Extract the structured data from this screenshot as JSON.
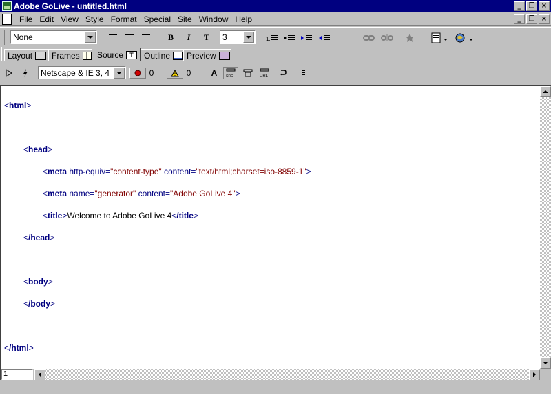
{
  "window": {
    "title": "Adobe GoLive - untitled.html"
  },
  "menu": [
    {
      "underline": "F",
      "rest": "ile"
    },
    {
      "underline": "E",
      "rest": "dit"
    },
    {
      "underline": "V",
      "rest": "iew"
    },
    {
      "underline": "S",
      "rest": "tyle"
    },
    {
      "underline": "F",
      "rest": "ormat"
    },
    {
      "underline": "S",
      "rest": "pecial"
    },
    {
      "underline": "S",
      "rest": "ite"
    },
    {
      "underline": "W",
      "rest": "indow"
    },
    {
      "underline": "H",
      "rest": "elp"
    }
  ],
  "toolbar": {
    "paragraph_format": "None",
    "bold": "B",
    "italic": "I",
    "teletype": "T",
    "font_size": "3"
  },
  "tabs": [
    "Layout",
    "Frames",
    "Source",
    "Outline",
    "Preview"
  ],
  "active_tab": "Source",
  "source_toolbar": {
    "browser_set": "Netscape & IE 3, 4",
    "errors": "0",
    "warnings": "0",
    "font_glyph": "A"
  },
  "code": {
    "html_open": "html",
    "head_open": "head",
    "meta1": {
      "tag": "meta",
      "attr1": "http-equiv=",
      "val1": "\"content-type\"",
      "attr2": "content=",
      "val2": "\"text/html;charset=iso-8859-1\""
    },
    "meta2": {
      "tag": "meta",
      "attr1": "name=",
      "val1": "\"generator\"",
      "attr2": "content=",
      "val2": "\"Adobe GoLive 4\""
    },
    "title": {
      "tag": "title",
      "text": "Welcome to Adobe GoLive 4",
      "close": "/title"
    },
    "head_close": "/head",
    "body_open": "body",
    "body_close": "/body",
    "html_close": "/html"
  },
  "status": {
    "line_number": "1"
  }
}
